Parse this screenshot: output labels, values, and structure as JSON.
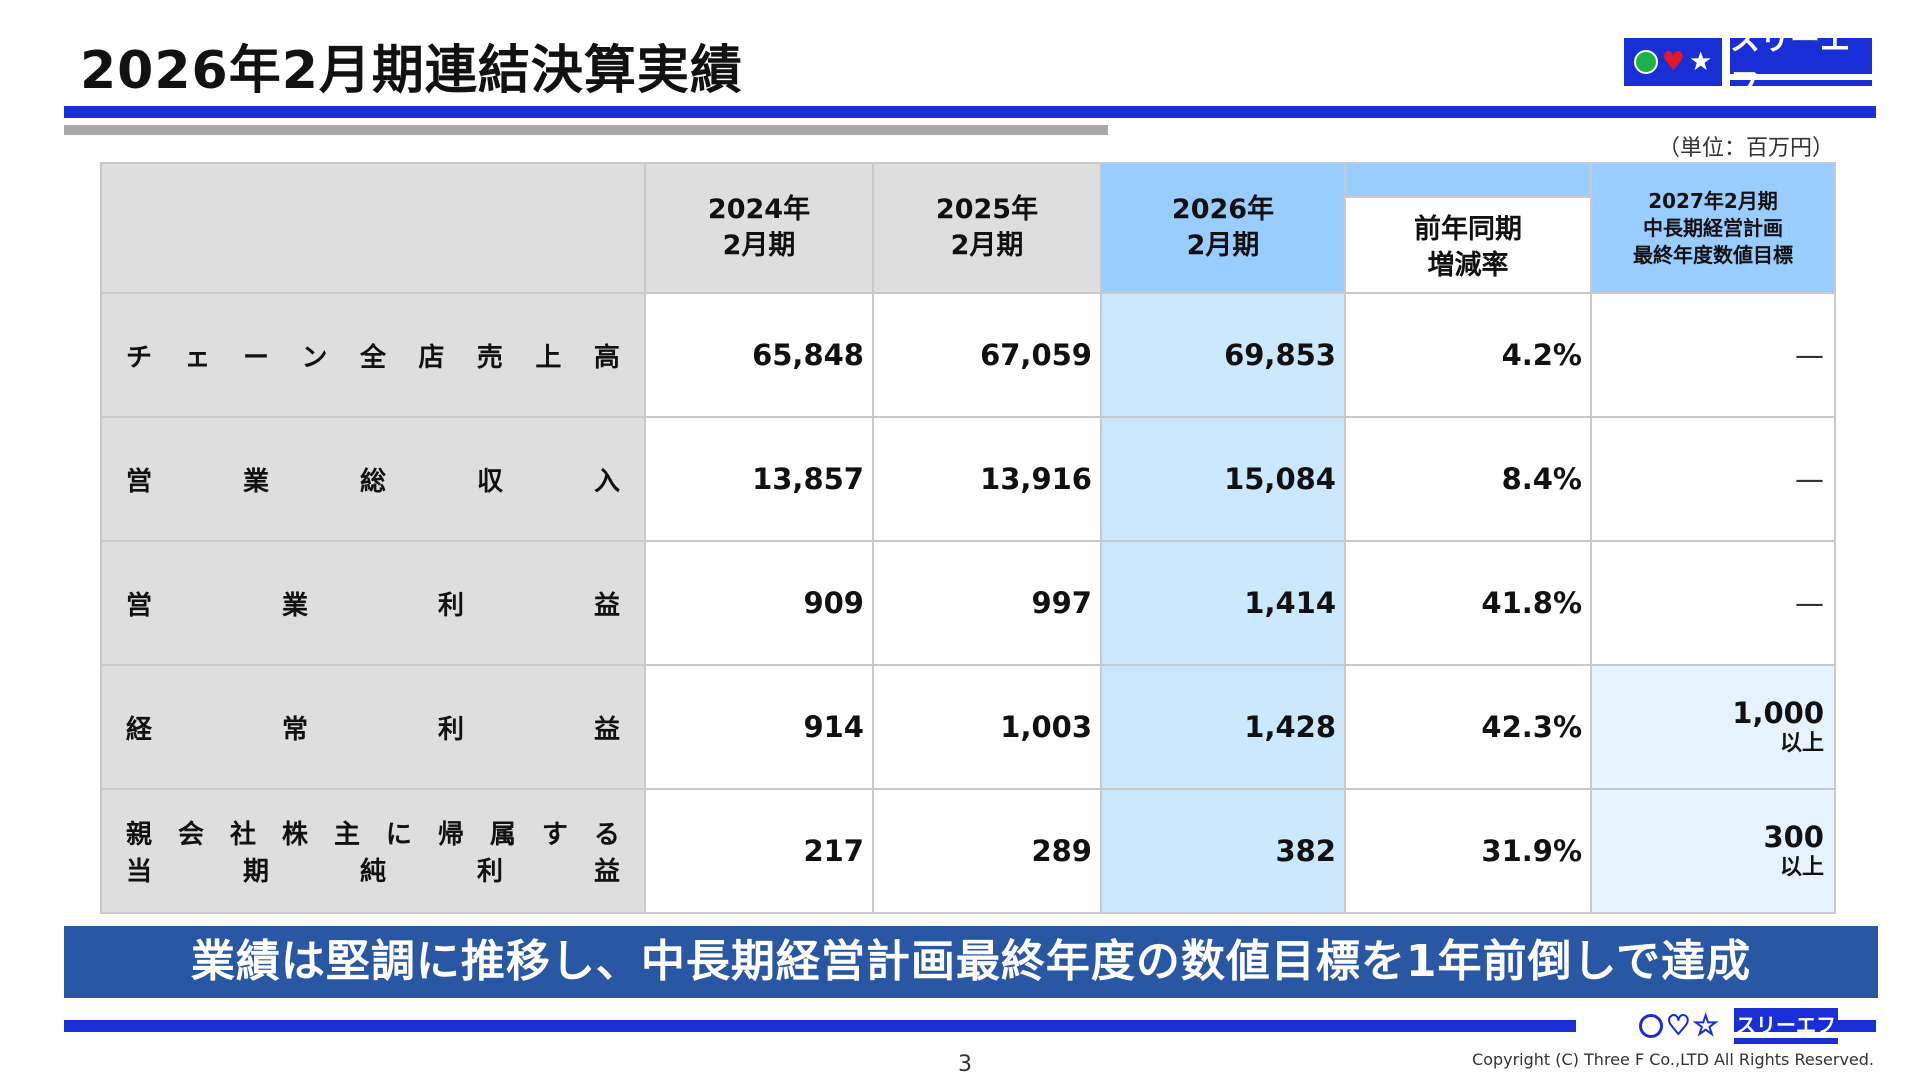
{
  "title": "2026年2月期連結決算実績",
  "unit_note": "（単位：百万円）",
  "logo": {
    "brand": "スリーエフ",
    "icons": [
      "circle-icon",
      "heart-icon",
      "star-icon"
    ]
  },
  "table": {
    "headers": {
      "fy2024": [
        "2024年",
        "2月期"
      ],
      "fy2025": [
        "2025年",
        "2月期"
      ],
      "fy2026": [
        "2026年",
        "2月期"
      ],
      "yoy": [
        "前年同期",
        "増減率"
      ],
      "plan": [
        "2027年2月期",
        "中長期経営計画",
        "最終年度数値目標"
      ]
    },
    "rows": [
      {
        "label": [
          [
            "チ",
            "ェ",
            "ー",
            "ン",
            "全",
            "店",
            "売",
            "上",
            "高"
          ]
        ],
        "fy2024": "65,848",
        "fy2025": "67,059",
        "fy2026": "69,853",
        "yoy": "4.2%",
        "plan": "—",
        "plan_sub": ""
      },
      {
        "label": [
          [
            "営",
            "業",
            "総",
            "収",
            "入"
          ]
        ],
        "fy2024": "13,857",
        "fy2025": "13,916",
        "fy2026": "15,084",
        "yoy": "8.4%",
        "plan": "—",
        "plan_sub": ""
      },
      {
        "label": [
          [
            "営",
            "業",
            "利",
            "益"
          ]
        ],
        "fy2024": "909",
        "fy2025": "997",
        "fy2026": "1,414",
        "yoy": "41.8%",
        "plan": "—",
        "plan_sub": ""
      },
      {
        "label": [
          [
            "経",
            "常",
            "利",
            "益"
          ]
        ],
        "fy2024": "914",
        "fy2025": "1,003",
        "fy2026": "1,428",
        "yoy": "42.3%",
        "plan": "1,000",
        "plan_sub": "以上"
      },
      {
        "label": [
          [
            "親",
            "会",
            "社",
            "株",
            "主",
            "に",
            "帰",
            "属",
            "す",
            "る"
          ],
          [
            "当",
            "期",
            "純",
            "利",
            "益"
          ]
        ],
        "fy2024": "217",
        "fy2025": "289",
        "fy2026": "382",
        "yoy": "31.9%",
        "plan": "300",
        "plan_sub": "以上"
      }
    ]
  },
  "banner": "業績は堅調に推移し、中長期経営計画最終年度の数値目標を1年前倒しで達成",
  "page_number": "3",
  "copyright": "Copyright (C) Three F Co.,LTD All Rights Reserved.",
  "colors": {
    "brand_blue": "#1a2ed6",
    "banner_blue": "#2a57a3",
    "header_highlight": "#99ccff",
    "cell_highlight": "#cce8ff"
  }
}
